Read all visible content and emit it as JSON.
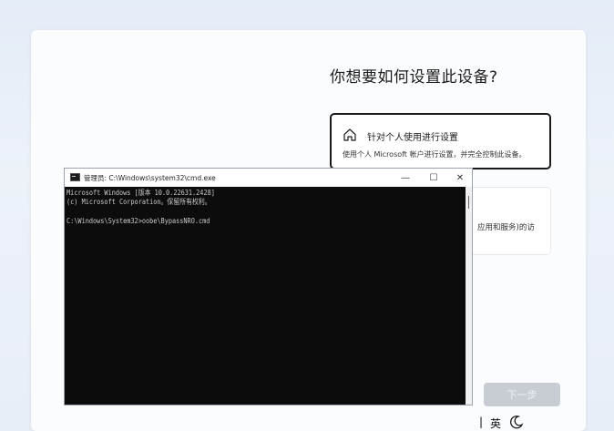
{
  "oobe": {
    "heading": "你想要如何设置此设备?",
    "personal_option": {
      "title": "针对个人使用进行设置",
      "description": "使用个人 Microsoft 帐户进行设置，并完全控制此设备。"
    },
    "work_option": {
      "description_fragment": "应用和服务)的访"
    },
    "next_label": "下一步"
  },
  "cmd": {
    "title": "管理员: C:\\Windows\\system32\\cmd.exe",
    "min_symbol": "—",
    "max_symbol": "☐",
    "close_symbol": "✕",
    "lines": [
      "Microsoft Windows [版本 10.0.22631.2428]",
      "(c) Microsoft Corporation。保留所有权利。",
      "",
      "C:\\Windows\\System32>oobe\\BypassNRO.cmd"
    ]
  },
  "taskbar": {
    "separator": "|",
    "ime_language": "英",
    "icons": [
      "home-icon",
      "moon-icon"
    ]
  }
}
